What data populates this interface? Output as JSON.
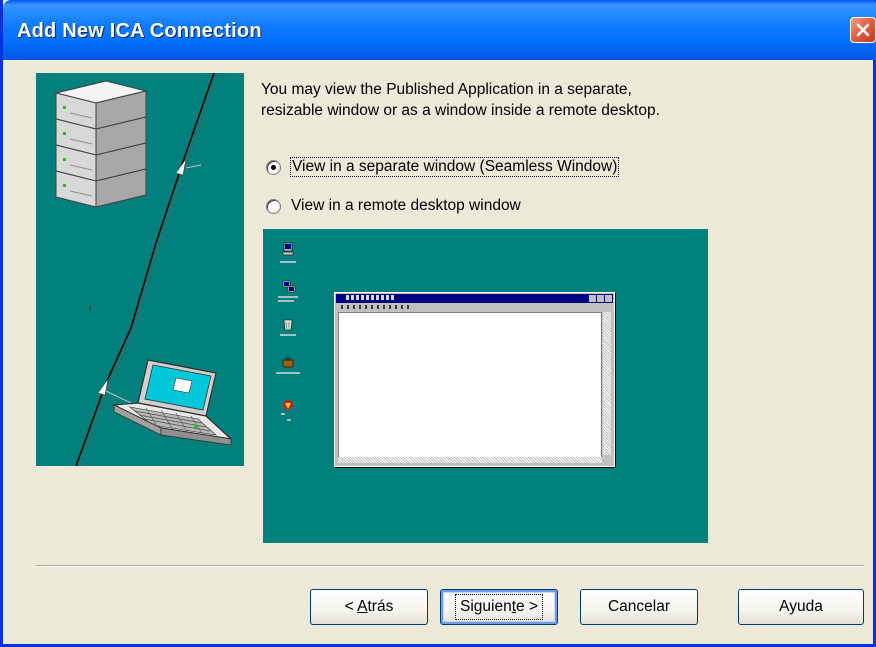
{
  "window": {
    "title": "Add New ICA Connection",
    "close_icon": "close-icon"
  },
  "colors": {
    "titlebar": "#0058EE",
    "dialog_bg": "#ECE9D8",
    "teal": "#00807C",
    "close_button": "#E2614A"
  },
  "intro": {
    "line1": "You may view the Published Application in a separate,",
    "line2": "resizable window or as a window inside a remote desktop."
  },
  "options": [
    {
      "label": "View in a separate window (Seamless Window)",
      "checked": true
    },
    {
      "label": "View in a remote desktop window",
      "checked": false
    }
  ],
  "buttons": {
    "back": {
      "pre": "< ",
      "accel": "A",
      "post": "trás"
    },
    "next": {
      "pre": "Siguien",
      "accel": "t",
      "post": "e >"
    },
    "cancel": "Cancelar",
    "help": "Ayuda"
  },
  "icons": {
    "art": [
      "server-stack-icon",
      "laptop-icon",
      "network-cable-icon"
    ],
    "desktop": [
      "my-computer-icon",
      "network-neighborhood-icon",
      "recycle-bin-icon",
      "my-briefcase-icon",
      "desktop-shortcut-icon"
    ]
  }
}
